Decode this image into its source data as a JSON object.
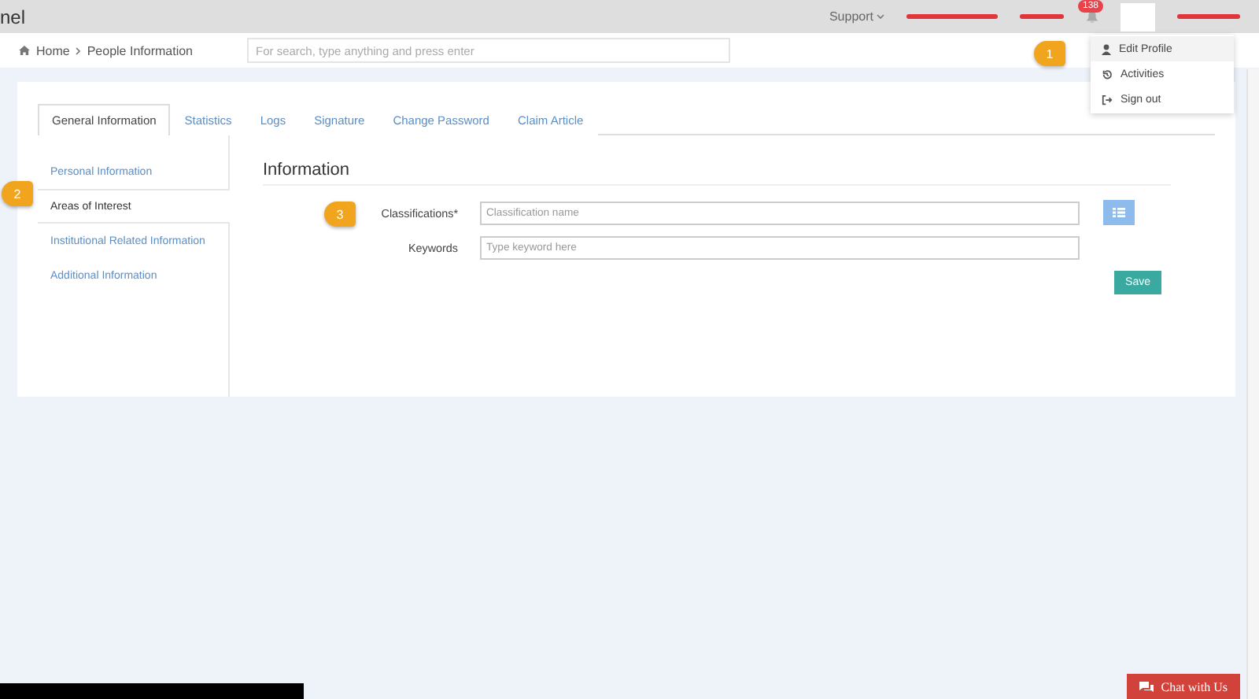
{
  "topbar": {
    "brand": "nel",
    "support": "Support",
    "notification_count": "138"
  },
  "breadcrumb": [
    {
      "label": "Home"
    },
    {
      "label": "People Information"
    }
  ],
  "search": {
    "placeholder": "For search, type anything and press enter"
  },
  "user_menu": [
    {
      "kind": "user",
      "label": "Edit Profile",
      "selected": true
    },
    {
      "kind": "history",
      "label": "Activities",
      "selected": false
    },
    {
      "kind": "signout",
      "label": "Sign out",
      "selected": false
    }
  ],
  "tabs": [
    {
      "label": "General Information",
      "selected": true
    },
    {
      "label": "Statistics",
      "selected": false
    },
    {
      "label": "Logs",
      "selected": false
    },
    {
      "label": "Signature",
      "selected": false
    },
    {
      "label": "Change Password",
      "selected": false
    },
    {
      "label": "Claim Article",
      "selected": false
    }
  ],
  "side_nav": [
    {
      "label": "Personal Information",
      "selected": false
    },
    {
      "label": "Areas of Interest",
      "selected": true
    },
    {
      "label": "Institutional Related Information",
      "selected": false
    },
    {
      "label": "Additional Information",
      "selected": false
    }
  ],
  "section_title": "Information",
  "fields": [
    {
      "label": "Classifications*",
      "placeholder": "Classification name",
      "list_button": true
    },
    {
      "label": "Keywords",
      "placeholder": "Type keyword here",
      "list_button": false
    }
  ],
  "save_button": "Save",
  "callouts": [
    "1",
    "2",
    "3"
  ],
  "chat_button": "Chat with Us"
}
